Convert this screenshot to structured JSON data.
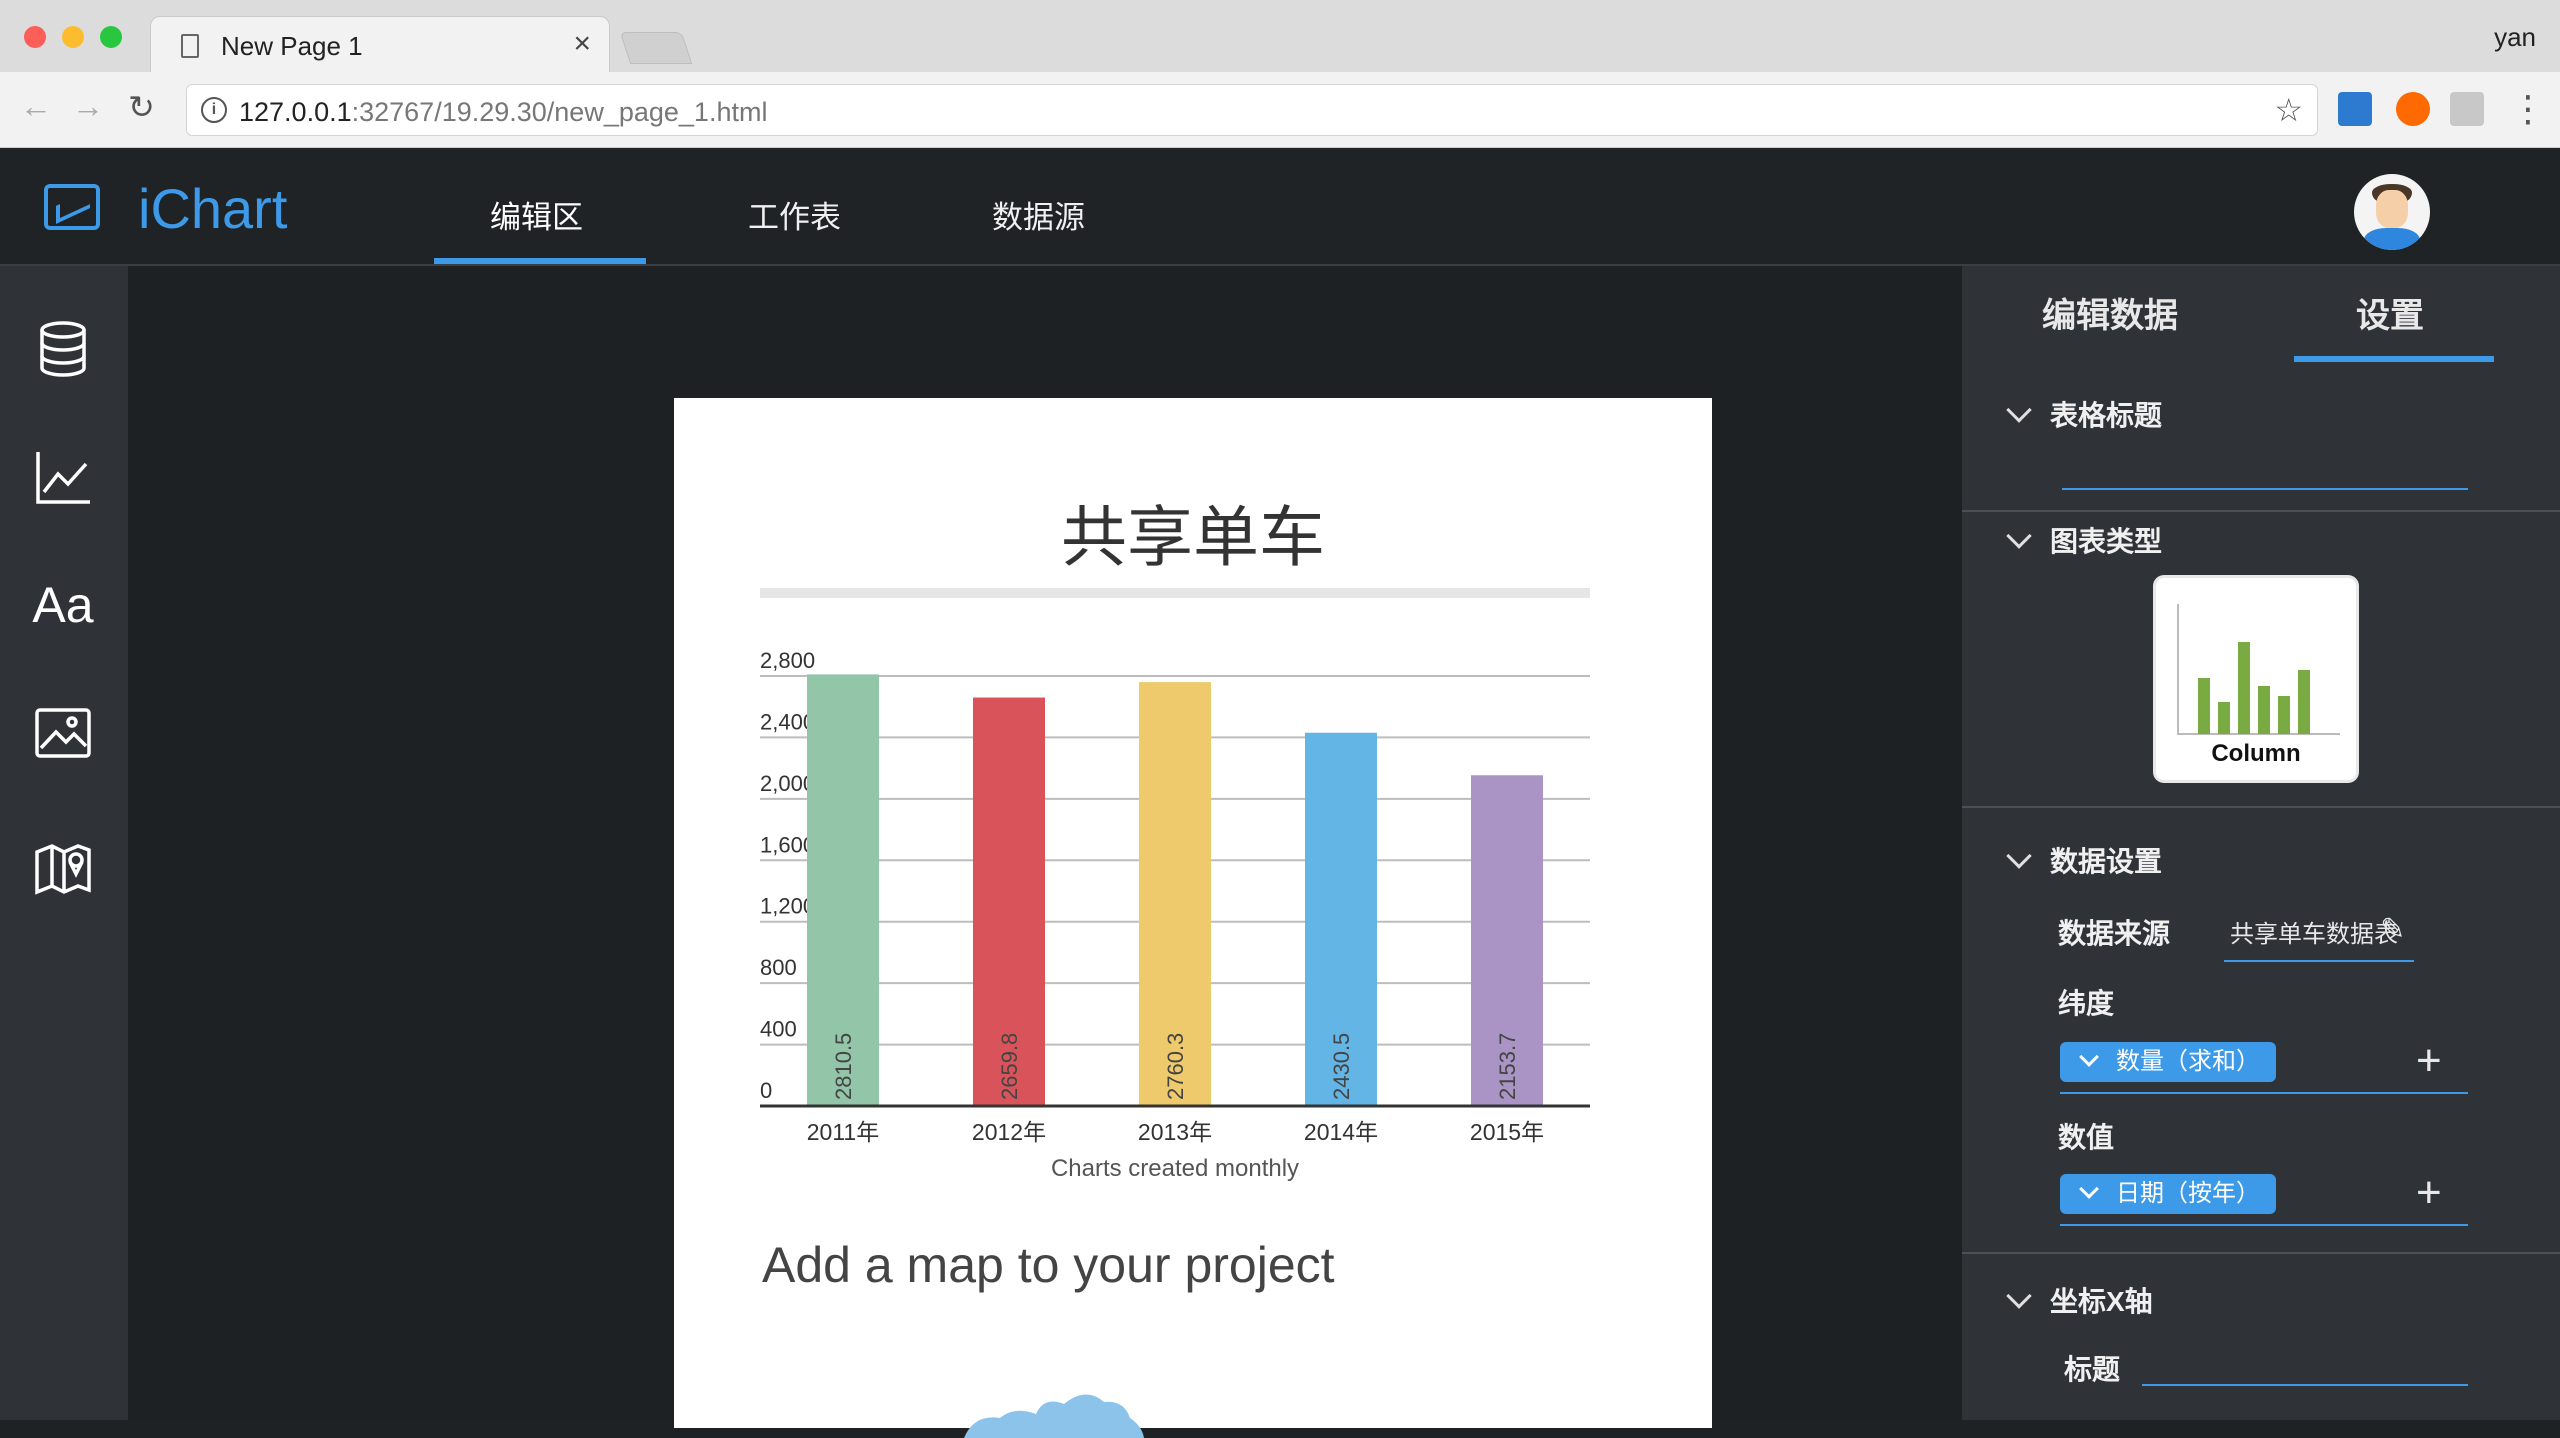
{
  "browser": {
    "tab_title": "New Page 1",
    "tab_close": "×",
    "user": "yan",
    "url_host": "127.0.0.1",
    "url_rest": ":32767/19.29.30/new_page_1.html",
    "info_glyph": "i",
    "star_glyph": "☆",
    "back_glyph": "←",
    "forward_glyph": "→",
    "reload_glyph": "↻",
    "menu_glyph": "⋮"
  },
  "app": {
    "logo_text": "iChart",
    "nav": [
      "编辑区",
      "工作表",
      "数据源"
    ],
    "active_nav": 0
  },
  "sidebar": {
    "icons": [
      "database-icon",
      "line-chart-icon",
      "text-icon",
      "image-icon",
      "map-icon"
    ],
    "text_icon_label": "Aa"
  },
  "chart_data": {
    "type": "bar",
    "title": "共享单车",
    "categories": [
      "2011年",
      "2012年",
      "2013年",
      "2014年",
      "2015年"
    ],
    "values": [
      2810.5,
      2659.8,
      2760.3,
      2430.5,
      2153.7
    ],
    "data_labels": [
      "2810.5",
      "2659.8",
      "2760.3",
      "2430.5",
      "2153.7"
    ],
    "bar_colors": [
      "#93c5a8",
      "#d9545a",
      "#efca6c",
      "#63b5e5",
      "#a994c5"
    ],
    "y_ticks": [
      "0",
      "400",
      "800",
      "1,200",
      "1,600",
      "2,000",
      "2,400",
      "2,800"
    ],
    "ylim": [
      0,
      2800
    ],
    "xlabel": "Charts created monthly",
    "ylabel": "",
    "grid": true
  },
  "canvas": {
    "map_heading": "Add a map to your project"
  },
  "panel": {
    "tabs": [
      "编辑数据",
      "设置"
    ],
    "active_tab": 1,
    "sections": {
      "table_title": "表格标题",
      "chart_type": "图表类型",
      "data_settings": "数据设置",
      "x_axis": "坐标X轴"
    },
    "chart_type_card": "Column",
    "data_source_label": "数据来源",
    "data_source_value": "共享单车数据表",
    "dimension_label": "纬度",
    "dimension_chip": "数量（求和）",
    "value_label": "数值",
    "value_chip": "日期（按年）",
    "x_title_label": "标题",
    "plus_glyph": "+",
    "pencil_glyph": "✎"
  },
  "colors": {
    "accent": "#3d9ae8",
    "header_bg": "#1f2326",
    "panel_bg": "#2f3338"
  }
}
